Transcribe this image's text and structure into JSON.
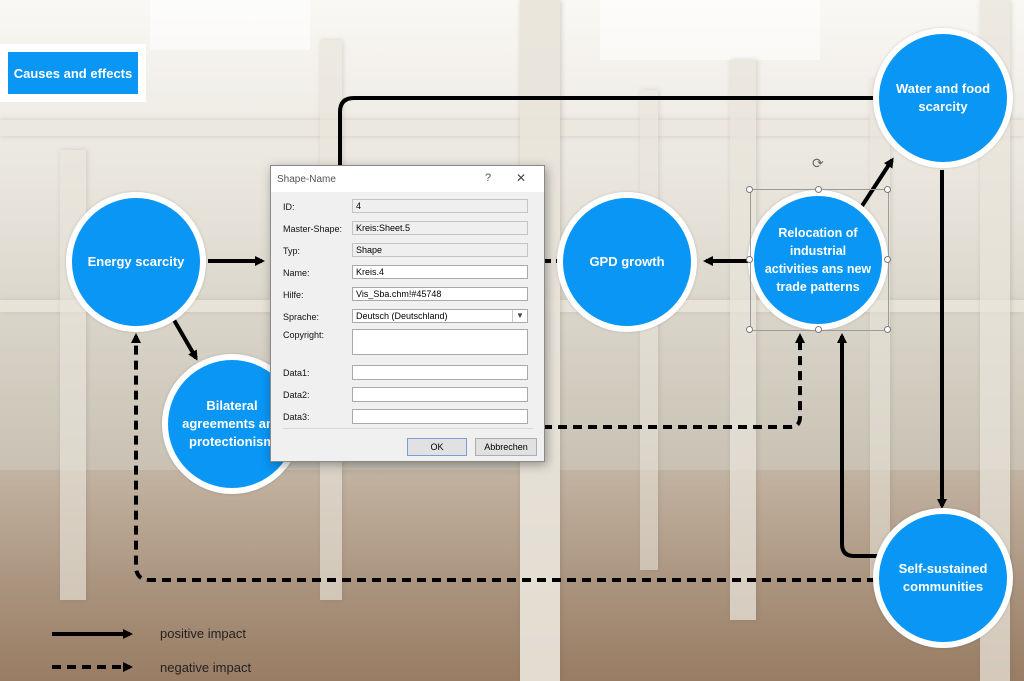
{
  "title": "Causes and effects",
  "nodes": {
    "energy": "Energy scarcity",
    "bilateral": "Bilateral agreements and protectionism",
    "gdp": "GPD growth",
    "relocation": "Relocation of industrial activities ans new trade patterns",
    "water": "Water and food scarcity",
    "self": "Self-sustained communities"
  },
  "legend": {
    "positive": "positive impact",
    "negative": "negative impact"
  },
  "dialog": {
    "title": "Shape-Name",
    "help_icon": "?",
    "close_icon": "✕",
    "labels": {
      "id": "ID:",
      "master": "Master-Shape:",
      "typ": "Typ:",
      "name": "Name:",
      "hilfe": "Hilfe:",
      "sprache": "Sprache:",
      "copyright": "Copyright:",
      "data1": "Data1:",
      "data2": "Data2:",
      "data3": "Data3:"
    },
    "values": {
      "id": "4",
      "master": "Kreis:Sheet.5",
      "typ": "Shape",
      "name": "Kreis.4",
      "hilfe": "Vis_Sba.chm!#45748",
      "sprache": "Deutsch (Deutschland)",
      "copyright": "",
      "data1": "",
      "data2": "",
      "data3": ""
    },
    "ok": "OK",
    "cancel": "Abbrechen"
  },
  "colors": {
    "node_fill": "#0a96f4",
    "node_border": "#ffffff",
    "arrow": "#000000"
  },
  "icons": {
    "rotate": "rotate-handle-icon",
    "dropdown": "chevron-down-icon"
  }
}
